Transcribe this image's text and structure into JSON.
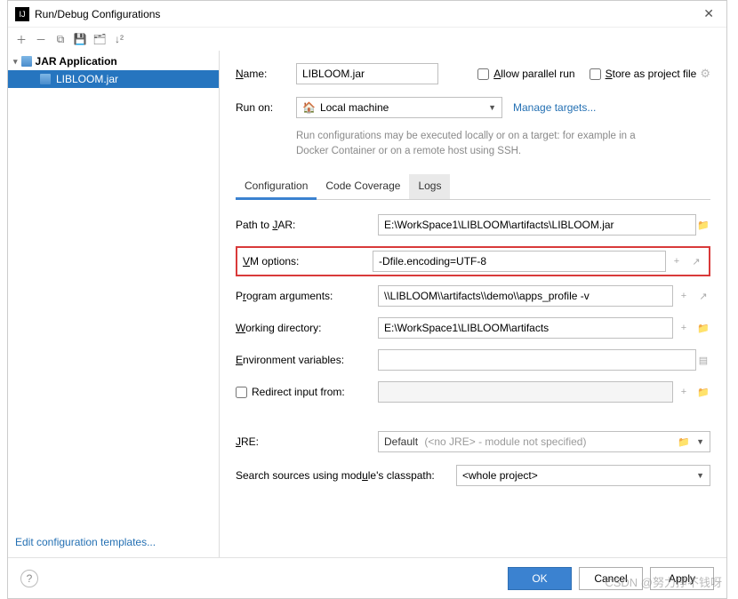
{
  "titlebar": {
    "title": "Run/Debug Configurations"
  },
  "sidebar": {
    "category": "JAR Application",
    "selected_item": "LIBLOOM.jar",
    "footer_link": "Edit configuration templates..."
  },
  "header": {
    "name_label": "Name:",
    "name_value": "LIBLOOM.jar",
    "allow_parallel": "Allow parallel run",
    "store_as": "Store as project file",
    "runon_label": "Run on:",
    "runon_value": "Local machine",
    "manage_targets": "Manage targets...",
    "hint": "Run configurations may be executed locally or on a target: for example in a Docker Container or on a remote host using SSH."
  },
  "tabs": {
    "configuration": "Configuration",
    "code_coverage": "Code Coverage",
    "logs": "Logs"
  },
  "form": {
    "path_to_jar_label": "Path to JAR:",
    "path_to_jar_value": "E:\\WorkSpace1\\LIBLOOM\\artifacts\\LIBLOOM.jar",
    "vm_options_label": "VM options:",
    "vm_options_value": "-Dfile.encoding=UTF-8",
    "program_args_label": "Program arguments:",
    "program_args_value": "\\\\LIBLOOM\\\\artifacts\\\\demo\\\\apps_profile -v",
    "working_dir_label": "Working directory:",
    "working_dir_value": "E:\\WorkSpace1\\LIBLOOM\\artifacts",
    "env_vars_label": "Environment variables:",
    "env_vars_value": "",
    "redirect_input": "Redirect input from:",
    "jre_label": "JRE:",
    "jre_default": "Default",
    "jre_gray": "(<no JRE> - module not specified)",
    "classpath_label": "Search sources using module's classpath:",
    "classpath_value": "<whole project>"
  },
  "footer": {
    "ok": "OK",
    "cancel": "Cancel",
    "apply": "Apply"
  },
  "watermark": "CSDN @努力挣不钱呀"
}
